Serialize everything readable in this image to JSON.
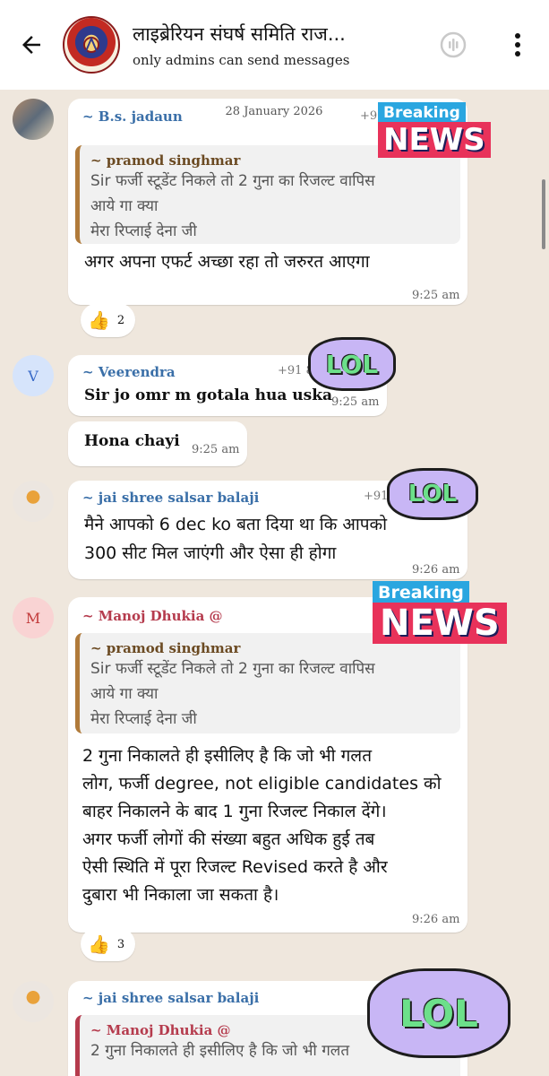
{
  "header": {
    "group_name": "लाइब्रेरियन संघर्ष समिति राज...",
    "subtitle": "only admins can send messages"
  },
  "date_separator": "28 January 2026",
  "messages": [
    {
      "sender": "~ B.s. jadaun",
      "phone": "+91",
      "quote_sender": "~ pramod singhmar",
      "quote_line1": "Sir फर्जी स्टूडेंट निकले तो 2 गुना का रिजल्ट वापिस",
      "quote_line2": "आये गा क्या",
      "quote_line3": "मेरा रिप्लाई देना जी",
      "text": "अगर अपना एफर्ट अच्छा रहा तो जरुरत आएगा",
      "time": "9:25 am",
      "reaction_count": "2"
    },
    {
      "sender": "~ Veerendra",
      "phone": "+91 8",
      "text": "Sir jo omr m gotala hua uska",
      "time": "9:25 am",
      "avatar_letter": "V"
    },
    {
      "text": "Hona chayi",
      "time": "9:25 am"
    },
    {
      "sender": "~ jai shree salsar balaji",
      "phone": "+91 9",
      "text_line1": "मैने आपको 6 dec ko बता दिया था कि आपको",
      "text_line2": "300 सीट मिल जाएंगी और ऐसा ही होगा",
      "time": "9:26 am"
    },
    {
      "sender": "~ Manoj Dhukia @",
      "avatar_letter": "M",
      "quote_sender": "~ pramod singhmar",
      "quote_line1": "Sir फर्जी स्टूडेंट निकले तो 2 गुना का रिजल्ट वापिस",
      "quote_line2": "आये गा क्या",
      "quote_line3": "मेरा रिप्लाई देना जी",
      "text_line1": "2 गुना निकालते ही इसीलिए है कि जो भी गलत",
      "text_line2": "लोग, फर्जी degree, not eligible candidates को",
      "text_line3": "बाहर निकालने के बाद 1 गुना रिजल्ट निकाल देंगे।",
      "text_line4": "अगर फर्जी लोगों की संख्या बहुत अधिक हुई तब",
      "text_line5": "ऐसी स्थिति में पूरा रिजल्ट Revised करते है और",
      "text_line6": "दुबारा भी निकाला जा सकता है।",
      "time": "9:26 am",
      "reaction_count": "3"
    },
    {
      "sender": "~ jai shree salsar balaji",
      "quote_sender": "~ Manoj Dhukia @",
      "quote_line1": "2 गुना निकालते ही इसीलिए है कि जो भी गलत"
    }
  ],
  "stickers": {
    "breaking": "Breaking",
    "news": "NEWS",
    "lol": "LOL"
  },
  "reaction_emoji": "👍",
  "colors": {
    "chat_bg": "#efe7dd",
    "bubble": "#ffffff",
    "sender_blue": "#3a6fa8",
    "sender_red": "#b53b4d"
  },
  "icons": [
    "back-arrow-icon",
    "call-icon",
    "more-vert-icon"
  ]
}
